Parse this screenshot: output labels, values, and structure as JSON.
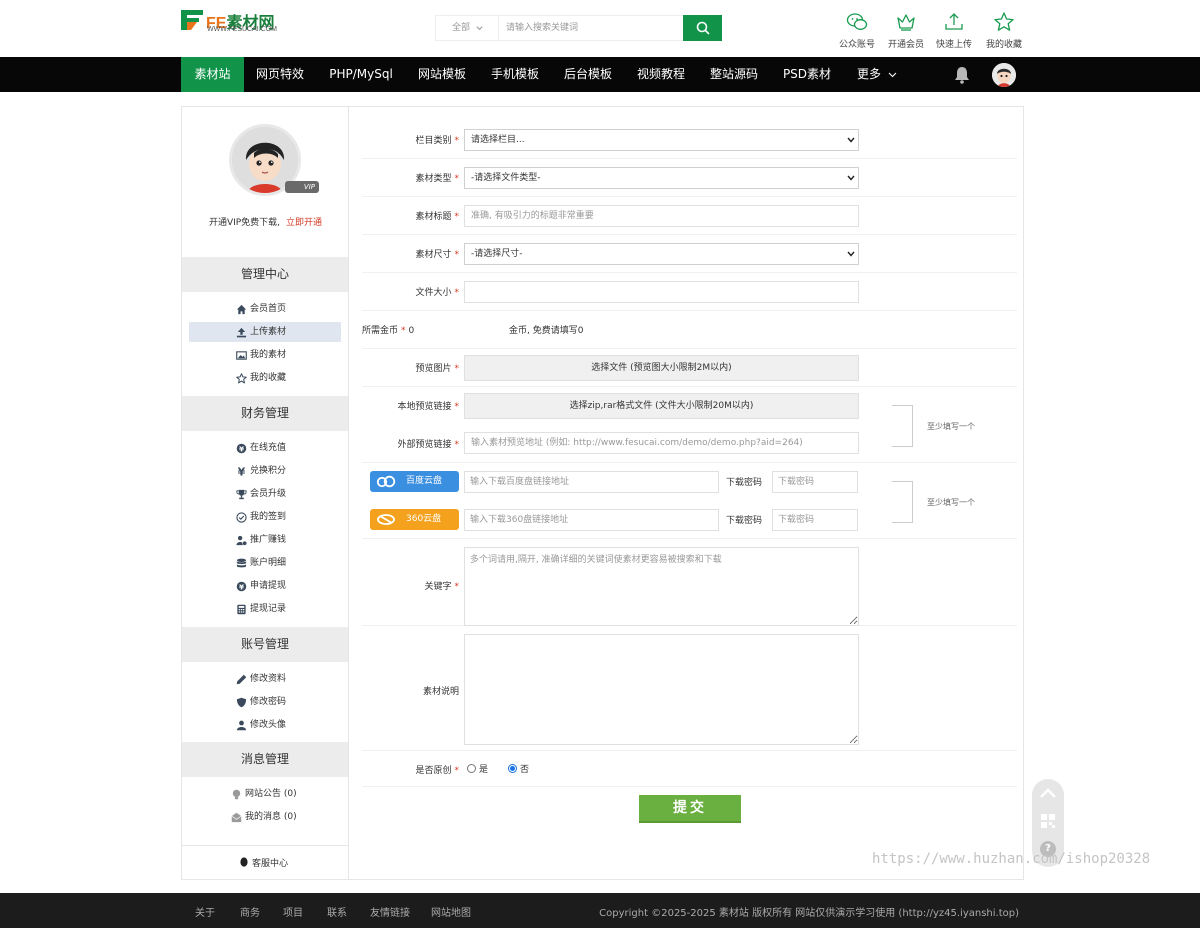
{
  "header": {
    "logo_text_a": "FE",
    "logo_text_b": "素材网",
    "logo_url": "WWW.FESUCAI.COM",
    "search_scope": "全部",
    "search_placeholder": "请输入搜索关键词",
    "icons": [
      {
        "label": "公众账号",
        "icon": "wechat-icon"
      },
      {
        "label": "开通会员",
        "icon": "crown-icon"
      },
      {
        "label": "快速上传",
        "icon": "upload-icon"
      },
      {
        "label": "我的收藏",
        "icon": "star-icon"
      }
    ]
  },
  "nav": {
    "items": [
      "素材站",
      "网页特效",
      "PHP/MySql",
      "网站模板",
      "手机模板",
      "后台模板",
      "视频教程",
      "整站源码",
      "PSD素材",
      "更多"
    ],
    "active_index": 0
  },
  "sidebar": {
    "vip_text": "开通VIP免费下载,",
    "vip_link": "立即开通",
    "vip_badge": "VIP",
    "groups": [
      {
        "title": "管理中心",
        "items": [
          {
            "label": "会员首页",
            "icon": "home-icon"
          },
          {
            "label": "上传素材",
            "icon": "upload-icon",
            "active": true
          },
          {
            "label": "我的素材",
            "icon": "image-icon"
          },
          {
            "label": "我的收藏",
            "icon": "star-icon"
          }
        ]
      },
      {
        "title": "财务管理",
        "items": [
          {
            "label": "在线充值",
            "icon": "yen-icon"
          },
          {
            "label": "兑换积分",
            "icon": "exchange-icon"
          },
          {
            "label": "会员升级",
            "icon": "trophy-icon"
          },
          {
            "label": "我的签到",
            "icon": "check-circle-icon"
          },
          {
            "label": "推广赚钱",
            "icon": "user-money-icon"
          },
          {
            "label": "账户明细",
            "icon": "database-icon"
          },
          {
            "label": "申请提现",
            "icon": "yen-icon"
          },
          {
            "label": "提现记录",
            "icon": "calculator-icon"
          }
        ]
      },
      {
        "title": "账号管理",
        "items": [
          {
            "label": "修改资料",
            "icon": "pencil-icon"
          },
          {
            "label": "修改密码",
            "icon": "shield-icon"
          },
          {
            "label": "修改头像",
            "icon": "user-icon"
          }
        ]
      },
      {
        "title": "消息管理",
        "items": [
          {
            "label": "网站公告 (0)",
            "icon": "bulb-icon"
          },
          {
            "label": "我的消息 (0)",
            "icon": "mail-icon"
          }
        ]
      }
    ],
    "service_label": "客服中心"
  },
  "form": {
    "category_label": "栏目类别",
    "category_value": "请选择栏目...",
    "filetype_label": "素材类型",
    "filetype_value": "-请选择文件类型-",
    "title_label": "素材标题",
    "title_placeholder": "准确, 有吸引力的标题非常重要",
    "size_label": "素材尺寸",
    "size_value": "-请选择尺寸-",
    "filesize_label": "文件大小",
    "coins_label": "所需金币",
    "coins_value": "0",
    "coins_hint": "金币, 免费请填写0",
    "preview_label": "预览图片",
    "preview_button": "选择文件 (预览图大小限制2M以内)",
    "local_label": "本地预览链接",
    "local_button": "选择zip,rar格式文件 (文件大小限制20M以内)",
    "external_label": "外部预览链接",
    "external_placeholder": "输入素材预览地址 (例如: http://www.fesucai.com/demo/demo.php?aid=264)",
    "at_least_one": "至少填写一个",
    "baidu_label": "百度云盘",
    "baidu_placeholder": "输入下载百度盘链接地址",
    "qihu_label": "360云盘",
    "qihu_placeholder": "输入下载360盘链接地址",
    "pwd_label": "下载密码",
    "pwd_placeholder": "下载密码",
    "keywords_label": "关键字",
    "keywords_placeholder": "多个词请用,隔开, 准确详细的关键词使素材更容易被搜索和下载",
    "desc_label": "素材说明",
    "original_label": "是否原创",
    "original_yes": "是",
    "original_no": "否",
    "original_selected": "否",
    "submit_label": "提交"
  },
  "watermark": "https://www.huzhan.com/ishop20328",
  "footer": {
    "links": [
      "关于",
      "商务",
      "项目",
      "联系",
      "友情链接",
      "网站地图"
    ],
    "copyright": "Copyright ©2025-2025 素材站 版权所有 网站仅供演示学习使用 (http://yz45.iyanshi.top)"
  },
  "colors": {
    "brand_green": "#12934a",
    "submit_green": "#6ab040",
    "baidu_blue": "#3b8fe0",
    "qihu_orange": "#f4a11d",
    "required_red": "#d23b26"
  }
}
